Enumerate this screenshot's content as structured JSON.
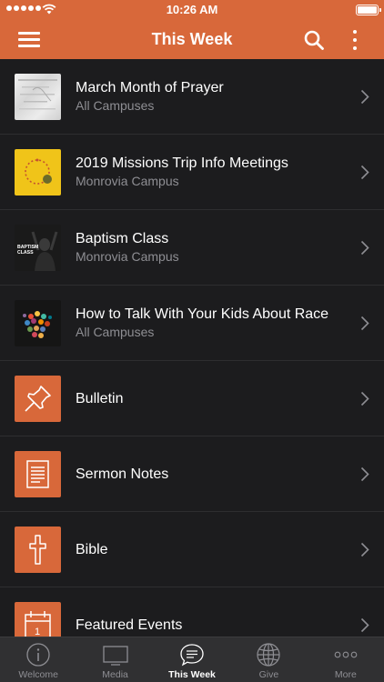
{
  "status": {
    "time": "10:26 AM"
  },
  "nav": {
    "title": "This Week"
  },
  "colors": {
    "accent": "#d8683a",
    "background": "#1c1c1e",
    "subtitle": "#8e8e93"
  },
  "items": [
    {
      "title": "March Month of Prayer",
      "subtitle": "All Campuses",
      "icon": "prayer-thumbnail"
    },
    {
      "title": "2019 Missions Trip Info Meetings",
      "subtitle": "Monrovia Campus",
      "icon": "missions-thumbnail"
    },
    {
      "title": "Baptism Class",
      "subtitle": "Monrovia Campus",
      "icon": "baptism-thumbnail",
      "thumb_text": "BAPTISM CLASS"
    },
    {
      "title": "How to Talk With Your Kids About Race",
      "subtitle": "All Campuses",
      "icon": "race-thumbnail"
    },
    {
      "title": "Bulletin",
      "subtitle": "",
      "icon": "pushpin-icon"
    },
    {
      "title": "Sermon Notes",
      "subtitle": "",
      "icon": "document-icon"
    },
    {
      "title": "Bible",
      "subtitle": "",
      "icon": "cross-icon"
    },
    {
      "title": "Featured Events",
      "subtitle": "",
      "icon": "calendar-icon"
    }
  ],
  "tabs": [
    {
      "label": "Welcome",
      "icon": "info-icon"
    },
    {
      "label": "Media",
      "icon": "tv-icon"
    },
    {
      "label": "This Week",
      "icon": "chat-icon",
      "active": true
    },
    {
      "label": "Give",
      "icon": "globe-icon"
    },
    {
      "label": "More",
      "icon": "ellipsis-icon"
    }
  ]
}
